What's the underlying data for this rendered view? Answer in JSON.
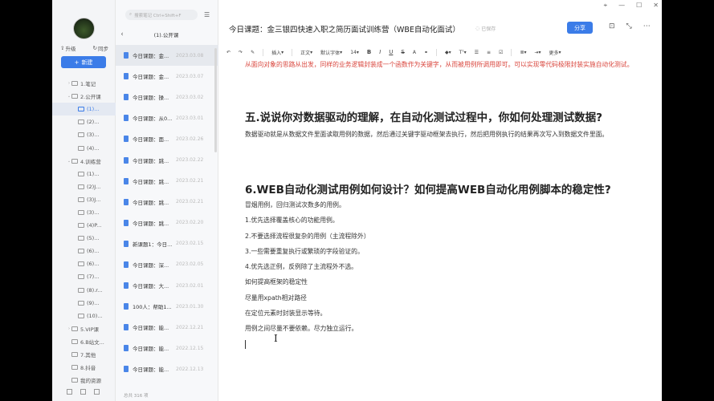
{
  "sidebar": {
    "upgrade_label": "升级",
    "sync_label": "同步",
    "new_button": "新建",
    "tree": [
      {
        "label": "1.笔记",
        "indent": 1,
        "caret": "›"
      },
      {
        "label": "2.公开课",
        "indent": 1,
        "caret": "⌄"
      },
      {
        "label": "(1)...",
        "indent": 2,
        "caret": "",
        "active": true
      },
      {
        "label": "(2)...",
        "indent": 2,
        "caret": ""
      },
      {
        "label": "(3)...",
        "indent": 2,
        "caret": ""
      },
      {
        "label": "(4)...",
        "indent": 2,
        "caret": ""
      },
      {
        "label": "4.训练营",
        "indent": 1,
        "caret": "⌄"
      },
      {
        "label": "(1)...",
        "indent": 2,
        "caret": ""
      },
      {
        "label": "(2)J...",
        "indent": 2,
        "caret": ""
      },
      {
        "label": "(3)J...",
        "indent": 2,
        "caret": ""
      },
      {
        "label": "(3)...",
        "indent": 2,
        "caret": ""
      },
      {
        "label": "(4)P...",
        "indent": 2,
        "caret": ""
      },
      {
        "label": "(5)...",
        "indent": 2,
        "caret": ""
      },
      {
        "label": "(6)...",
        "indent": 2,
        "caret": ""
      },
      {
        "label": "(6)...",
        "indent": 2,
        "caret": ""
      },
      {
        "label": "(7)...",
        "indent": 2,
        "caret": ""
      },
      {
        "label": "(8).r...",
        "indent": 2,
        "caret": ""
      },
      {
        "label": "(9)...",
        "indent": 2,
        "caret": ""
      },
      {
        "label": "(10)...",
        "indent": 2,
        "caret": ""
      },
      {
        "label": "5.VIP课",
        "indent": 1,
        "caret": "›"
      },
      {
        "label": "6.B站文...",
        "indent": 1,
        "caret": ""
      },
      {
        "label": "7.其他",
        "indent": 1,
        "caret": ""
      },
      {
        "label": "8.抖音",
        "indent": 1,
        "caret": ""
      },
      {
        "label": "我的资源",
        "indent": 1,
        "caret": ""
      }
    ]
  },
  "notes": {
    "search_placeholder": "搜索笔记 Ctrl+Shift+F",
    "list_title": "(1).公开课",
    "items": [
      {
        "title": "今日课题：金...",
        "date": "2023.03.08",
        "active": true
      },
      {
        "title": "今日课题：金...",
        "date": "2023.03.07"
      },
      {
        "title": "今日课题：操...",
        "date": "2023.03.02"
      },
      {
        "title": "今日课题：从0...",
        "date": "2023.03.01"
      },
      {
        "title": "今日课题：面...",
        "date": "2023.02.26"
      },
      {
        "title": "今日课题：跳...",
        "date": "2023.02.22"
      },
      {
        "title": "今日课题：跳...",
        "date": "2023.02.21"
      },
      {
        "title": "今日课题：跳...",
        "date": "2023.02.21"
      },
      {
        "title": "今日课题：跳...",
        "date": "2023.02.20"
      },
      {
        "title": "新课题1：今日...",
        "date": "2023.02.15"
      },
      {
        "title": "今日课题：深...",
        "date": "2023.02.05"
      },
      {
        "title": "今日课题：大...",
        "date": "2023.02.01"
      },
      {
        "title": "100人：帮助1...",
        "date": "2023.01.30"
      },
      {
        "title": "今日课题：能...",
        "date": "2022.12.21"
      },
      {
        "title": "今日课题：能...",
        "date": "2022.12.15"
      },
      {
        "title": "今日课题：能...",
        "date": "2022.12.13"
      }
    ],
    "total": "总共 316 项"
  },
  "editor": {
    "title": "今日课题：金三银四快速入职之简历面试训练营（WBE自动化面试）",
    "saved": "已保存",
    "share": "分享",
    "toolbar": {
      "insert": "插入",
      "body": "正文",
      "font": "默认字体",
      "size": "14",
      "more": "更多"
    },
    "red_para": "从面向对象的思路从出发，同样的业务逻辑封装成一个函数作为关键字，从而被用例所调用即可。可以实现零代码极限封装实施自动化测试。",
    "h5": "五.说说你对数据驱动的理解，在自动化测试过程中，你如何处理测试数据?",
    "p5": "数据驱动就是从数据文件里面读取用例的数据，然后通过关键字驱动框架去执行，然后把用例执行的结果再次写入到数据文件里面。",
    "h6": "6.WEB自动化测试用例如何设计？如何提高WEB自动化用例脚本的稳定性?",
    "lines": [
      "冒烟用例，回归测试次数多的用例。",
      "1.优先选择覆盖核心的功能用例。",
      "2.不要选择流程很复杂的用例（主流程除外）",
      "3.一些需要重复执行或繁琐的字段验证的。",
      "4.优先选正例，反例除了主流程外不选。",
      "如何提高框架的稳定性",
      "尽量用xpath相对路径",
      "在定位元素时封装显示等待。",
      "用例之间尽量不要依赖。尽力独立运行。"
    ]
  }
}
